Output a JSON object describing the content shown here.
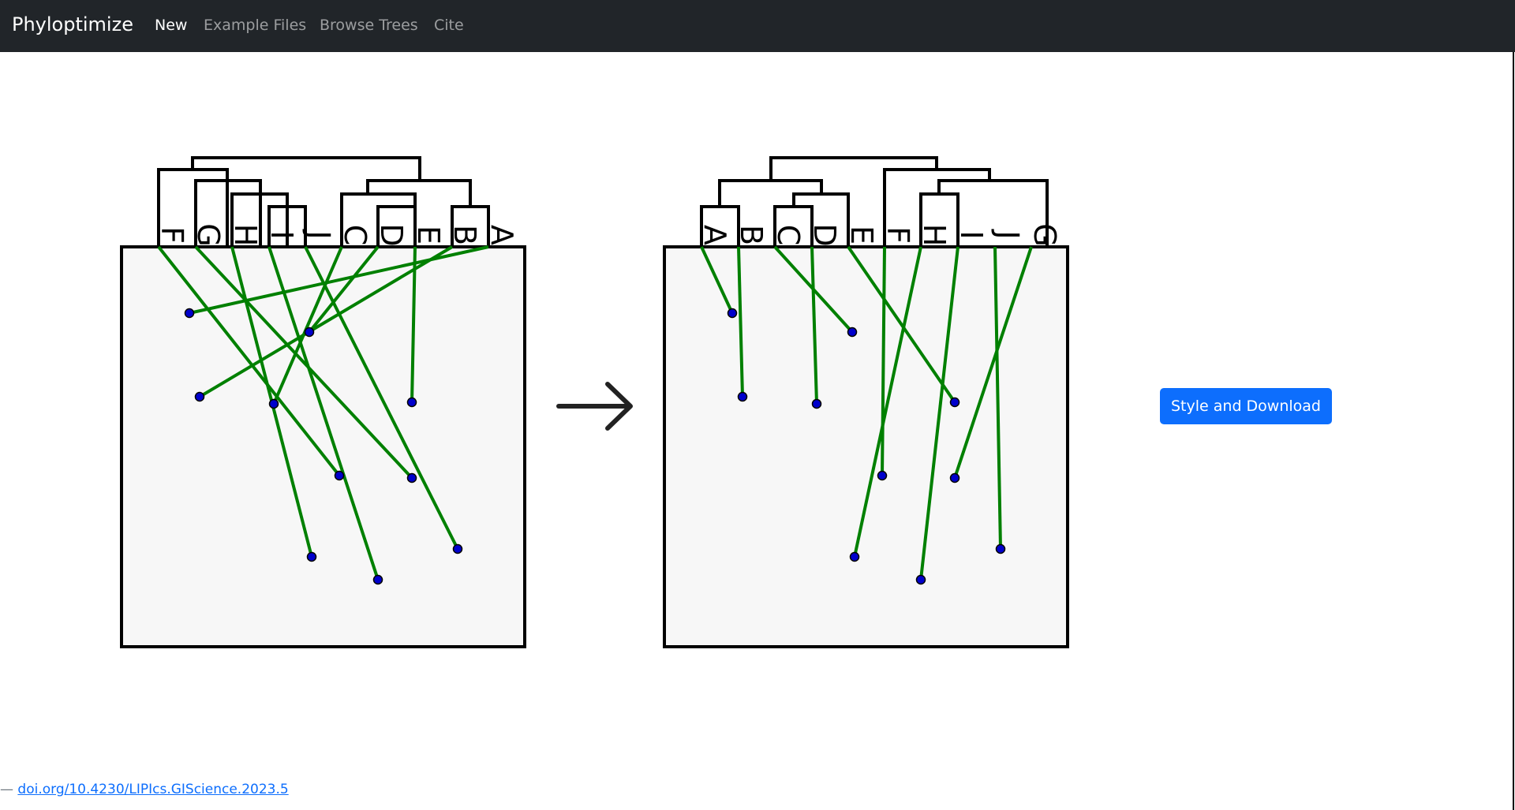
{
  "navbar": {
    "brand": "Phyloptimize",
    "links": [
      "New",
      "Example Files",
      "Browse Trees",
      "Cite"
    ],
    "active": "New"
  },
  "before": {
    "leaves": [
      "F",
      "G",
      "H",
      "I",
      "J",
      "C",
      "D",
      "E",
      "B",
      "A"
    ]
  },
  "after": {
    "leaves": [
      "A",
      "B",
      "C",
      "D",
      "E",
      "F",
      "H",
      "I",
      "J",
      "G"
    ]
  },
  "actions": {
    "style_download_label": "Style and Download"
  },
  "footer": {
    "dash": "—",
    "doi_link": "doi.org/10.4230/LIPIcs.GIScience.2023.5"
  },
  "colors": {
    "navbar_bg": "#212529",
    "connector": "#008000",
    "point": "#0000cc",
    "panel_bg": "#f7f7f7",
    "button": "#0d6efd"
  },
  "icons": {
    "transform_arrow": "arrow-right-icon"
  }
}
